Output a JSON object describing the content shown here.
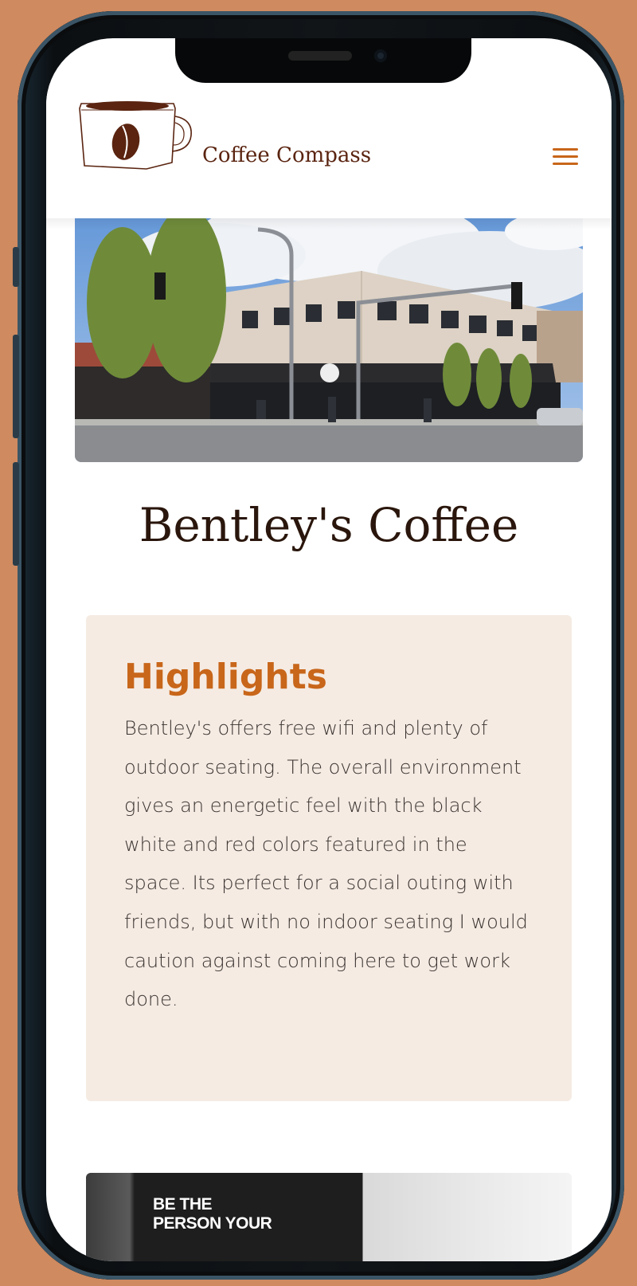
{
  "header": {
    "brand_name": "Coffee Compass",
    "logo_icon": "coffee-mug-logo",
    "menu_icon": "hamburger-menu-icon"
  },
  "hero": {
    "image": "street corner building with coffee shop"
  },
  "shop": {
    "name": "Bentley's Coffee"
  },
  "highlights": {
    "heading": "Highlights",
    "body": "Bentley's offers free wifi and plenty of outdoor seating. The overall environment gives an energetic feel with the black white and red colors featured in the space. Its perfect for a social outing with friends, but with no indoor seating I would caution against coming here to get work done."
  },
  "bottom_photo": {
    "poster_line1": "BE THE",
    "poster_line2": "PERSON YOUR"
  },
  "colors": {
    "background": "#cf8a60",
    "accent": "#c8661a",
    "brand_text": "#5a2410",
    "card_bg": "#f5ebe3",
    "title_text": "#2a160c"
  }
}
